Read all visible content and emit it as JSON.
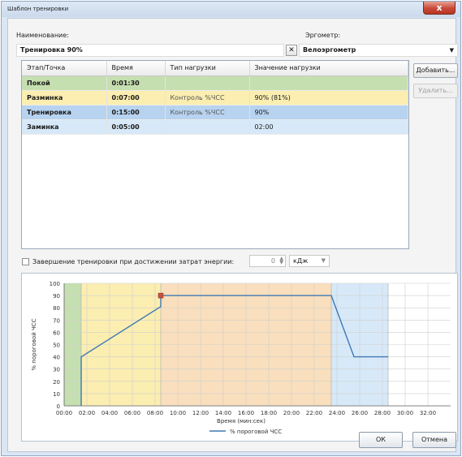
{
  "window": {
    "title": "Шаблон тренировки",
    "close": "x"
  },
  "form": {
    "name_label": "Наименование:",
    "name_value": "Тренировка 90%",
    "clear": "✕",
    "ergometer_label": "Эргометр:",
    "ergometer_value": "Велоэргометр"
  },
  "table": {
    "columns": [
      "Этап/Точка",
      "Время",
      "Тип нагрузки",
      "Значение нагрузки"
    ],
    "rows": [
      {
        "stage": "Покой",
        "time": "0:01:30",
        "type": "",
        "value": "",
        "color": "#c6dfb0"
      },
      {
        "stage": "Разминка",
        "time": "0:07:00",
        "type": "Контроль %ЧСС",
        "value": "90% (81%)",
        "color": "#fbeeb0"
      },
      {
        "stage": "Тренировка",
        "time": "0:15:00",
        "type": "Контроль %ЧСС",
        "value": "90%",
        "color": "#f9dfbd"
      },
      {
        "stage": "Заминка",
        "time": "0:05:00",
        "type": "",
        "value": "02:00",
        "color": "#d7e9f8"
      }
    ]
  },
  "buttons": {
    "add": "Добавить...",
    "remove": "Удалить...",
    "ok": "ОК",
    "cancel": "Отмена"
  },
  "energy": {
    "label": "Завершение тренировки при достижении затрат энергии:",
    "value": "0",
    "unit": "кДж"
  },
  "colors": {
    "selected_row": "#b7d3f0",
    "line": "#3f78b4",
    "marker": "#c8503c",
    "zone_rest": "#c6dfb0",
    "zone_warmup": "#fbeeb0",
    "zone_training": "#f9dfbd",
    "zone_cooldown": "#d7e9f8"
  },
  "chart_data": {
    "type": "line",
    "xlabel": "Время (мин:сек)",
    "ylabel": "% пороговой ЧСС",
    "x_ticks": [
      "00:00",
      "02:00",
      "04:00",
      "06:00",
      "08:00",
      "10:00",
      "12:00",
      "14:00",
      "16:00",
      "18:00",
      "20:00",
      "22:00",
      "24:00",
      "26:00",
      "28:00",
      "30:00",
      "32:00"
    ],
    "y_ticks": [
      "0",
      "10",
      "20",
      "30",
      "40",
      "50",
      "60",
      "70",
      "80",
      "90",
      "100"
    ],
    "xlim": [
      0,
      34
    ],
    "ylim": [
      0,
      100
    ],
    "zones": [
      {
        "name": "Покой",
        "x0": 0,
        "x1": 1.5
      },
      {
        "name": "Разминка",
        "x0": 1.5,
        "x1": 8.5
      },
      {
        "name": "Тренировка",
        "x0": 8.5,
        "x1": 23.5
      },
      {
        "name": "Заминка",
        "x0": 23.5,
        "x1": 28.5
      }
    ],
    "series": [
      {
        "name": "% пороговой ЧСС",
        "x": [
          1.5,
          1.5,
          8.5,
          8.5,
          23.5,
          25.5,
          28.5
        ],
        "y": [
          0,
          40,
          81,
          90,
          90,
          40,
          40
        ]
      }
    ],
    "marker": {
      "x": 8.5,
      "y": 90
    },
    "legend": "bottom"
  }
}
